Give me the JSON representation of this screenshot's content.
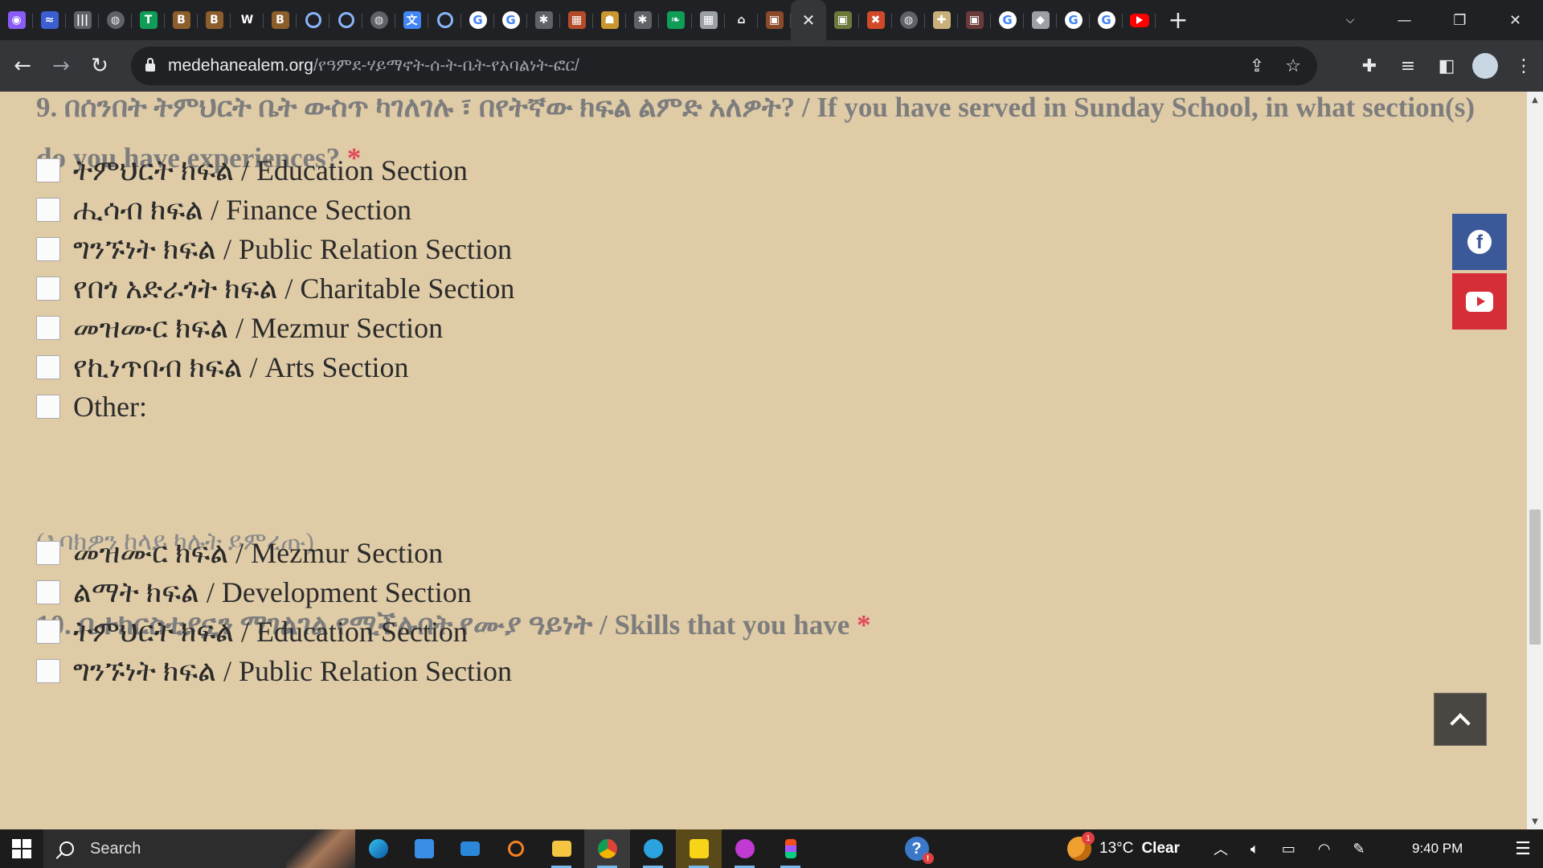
{
  "browser": {
    "tabs": [
      {
        "icon": "copilot-icon",
        "color": "#8a5cf6",
        "glyph": "◉"
      },
      {
        "icon": "wave-icon",
        "color": "#3b5fd0",
        "glyph": "≈"
      },
      {
        "icon": "bars-icon",
        "color": "#5f6368",
        "glyph": "|||"
      },
      {
        "icon": "globe-icon",
        "color": "#5f6368",
        "glyph": "◍"
      },
      {
        "icon": "t-icon",
        "color": "#0f9d58",
        "glyph": "T"
      },
      {
        "icon": "bookmark-icon",
        "color": "#8b5e2b",
        "glyph": "B"
      },
      {
        "icon": "bookmark-icon",
        "color": "#8b5e2b",
        "glyph": "B"
      },
      {
        "icon": "w-icon",
        "color": "#202124",
        "glyph": "W"
      },
      {
        "icon": "bookmark-icon",
        "color": "#8b5e2b",
        "glyph": "B"
      },
      {
        "icon": "ring-icon",
        "color": "",
        "glyph": ""
      },
      {
        "icon": "ring-icon",
        "color": "",
        "glyph": ""
      },
      {
        "icon": "globe-icon",
        "color": "#5f6368",
        "glyph": "◍"
      },
      {
        "icon": "translate-icon",
        "color": "#4285f4",
        "glyph": "文"
      },
      {
        "icon": "ring-icon",
        "color": "",
        "glyph": ""
      },
      {
        "icon": "google-icon",
        "color": "",
        "glyph": "G"
      },
      {
        "icon": "google-icon",
        "color": "",
        "glyph": "G"
      },
      {
        "icon": "emblem-icon",
        "color": "#5f6368",
        "glyph": "✱"
      },
      {
        "icon": "mosaic-icon",
        "color": "#b34a2a",
        "glyph": "▦"
      },
      {
        "icon": "icon-image-icon",
        "color": "#c9962f",
        "glyph": "☗"
      },
      {
        "icon": "emblem-icon",
        "color": "#5f6368",
        "glyph": "✱"
      },
      {
        "icon": "leaf-icon",
        "color": "#0f9d58",
        "glyph": "❧"
      },
      {
        "icon": "grid-icon",
        "color": "#9aa0a6",
        "glyph": "▦"
      },
      {
        "icon": "church-icon",
        "color": "#202124",
        "glyph": "⌂"
      },
      {
        "icon": "painting-icon",
        "color": "#8b4a2b",
        "glyph": "▣"
      },
      {
        "icon": "close-icon",
        "color": "",
        "glyph": "✕",
        "active": true
      },
      {
        "icon": "painting-icon",
        "color": "#6b7a3a",
        "glyph": "▣"
      },
      {
        "icon": "joomla-icon",
        "color": "#d04a2a",
        "glyph": "✖"
      },
      {
        "icon": "globe-icon",
        "color": "#5f6368",
        "glyph": "◍"
      },
      {
        "icon": "cross-icon",
        "color": "#c9b07a",
        "glyph": "✚"
      },
      {
        "icon": "painting-icon",
        "color": "#6b3a3a",
        "glyph": "▣"
      },
      {
        "icon": "google-icon",
        "color": "",
        "glyph": "G"
      },
      {
        "icon": "layers-icon",
        "color": "#9aa0a6",
        "glyph": "◆"
      },
      {
        "icon": "google-icon",
        "color": "",
        "glyph": "G"
      },
      {
        "icon": "google-icon",
        "color": "",
        "glyph": "G"
      },
      {
        "icon": "youtube-icon",
        "color": "",
        "glyph": ""
      }
    ],
    "url_host": "medehanealem.org",
    "url_path": "/የዓምደ-ሃይማኖት-ሰ-ት-ቤት-የአባልነት-ፎር/"
  },
  "form": {
    "q9": {
      "title": "9. በሰንበት ትምህርት ቤት ውስጥ ካገለገሉ ፣ በየትኛው ክፍል ልምድ አለዎት? / If you have served in Sunday School, in what section(s) do you have experiences?",
      "required": "*",
      "options": [
        "ትምህርት ክፍል / Education Section",
        "ሒሳብ ክፍል / Finance Section",
        "ግንኙነት ክፍል / Public Relation Section",
        "የበጎ አድራጎት ክፍል / Charitable Section",
        "መዝሙር ክፍል / Mezmur Section",
        "የኪነጥበብ ክፍል / Arts Section",
        "Other:"
      ],
      "hint": "(እባክዎን ከላይ ካሉት ይምረጡ)"
    },
    "q10": {
      "title": "10. ቤተክርስቲያኗን ማገልገል የሚችሉበት የሙያ ዓይነት / Skills that you have",
      "required": "*",
      "options": [
        "መዝሙር ክፍል / Mezmur Section",
        "ልማት ክፍል / Development Section",
        "ትምህርት ክፍል / Education Section",
        "ግንኙነት ክፍል / Public Relation Section"
      ]
    }
  },
  "social": {
    "facebook": "f"
  },
  "taskbar": {
    "search_label": "Search",
    "weather_badge": "1",
    "temperature": "13°C",
    "condition": "Clear",
    "time": "9:40 PM"
  }
}
